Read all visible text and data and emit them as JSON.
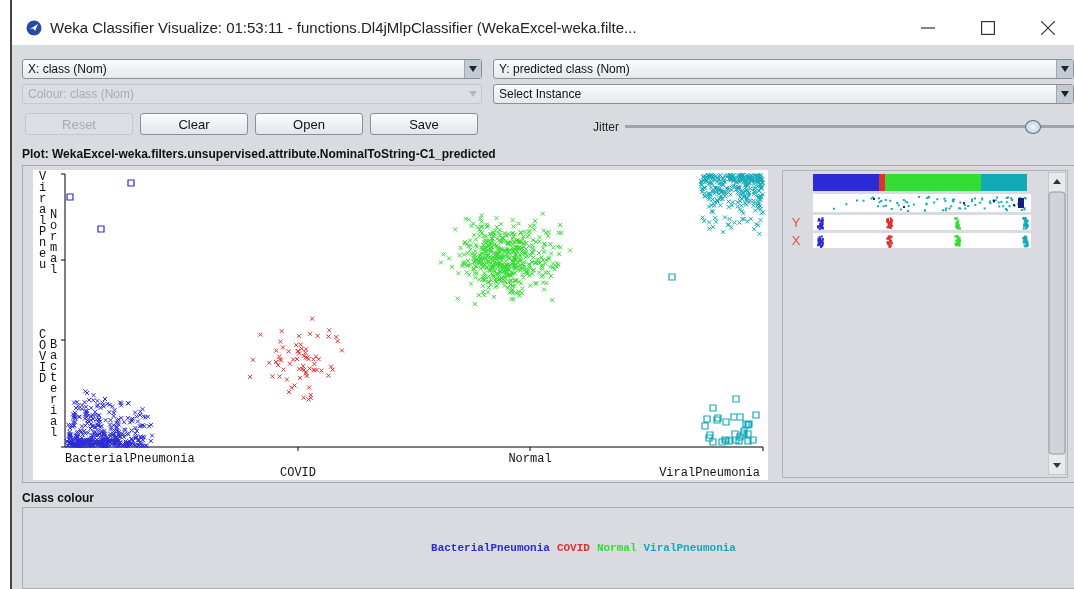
{
  "window": {
    "title": "Weka Classifier Visualize: 01:53:11 - functions.Dl4jMlpClassifier (WekaExcel-weka.filte..."
  },
  "controls": {
    "x_axis": {
      "value": "X: class (Nom)",
      "disabled": false
    },
    "y_axis": {
      "value": "Y: predicted class (Nom)",
      "disabled": false
    },
    "colour": {
      "value": "Colour: class (Nom)",
      "disabled": true
    },
    "instance": {
      "value": "Select Instance",
      "disabled": false
    }
  },
  "buttons": [
    {
      "label": "Reset",
      "disabled": true
    },
    {
      "label": "Clear",
      "disabled": false
    },
    {
      "label": "Open",
      "disabled": false
    },
    {
      "label": "Save",
      "disabled": false
    }
  ],
  "jitter": {
    "label": "Jitter",
    "level": 0.9
  },
  "plot": {
    "title": "Plot: WekaExcel-weka.filters.unsupervised.attribute.NominalToString-C1_predicted",
    "y_labels": [
      "ViralPneu",
      "Normal",
      "COVID",
      "Bacterial"
    ],
    "x_labels": [
      "BacterialPneumonia",
      "COVID",
      "Normal",
      "ViralPneumonia"
    ]
  },
  "attribute_panel": {
    "rows": [
      {
        "label": "Y"
      },
      {
        "label": "X"
      }
    ]
  },
  "class_colour": {
    "title": "Class colour",
    "classes": [
      {
        "name": "BacterialPneumonia",
        "color": "#2b2bd6"
      },
      {
        "name": "COVID",
        "color": "#e03030"
      },
      {
        "name": "Normal",
        "color": "#33dd33"
      },
      {
        "name": "ViralPneumonia",
        "color": "#14a9b8"
      }
    ]
  }
}
